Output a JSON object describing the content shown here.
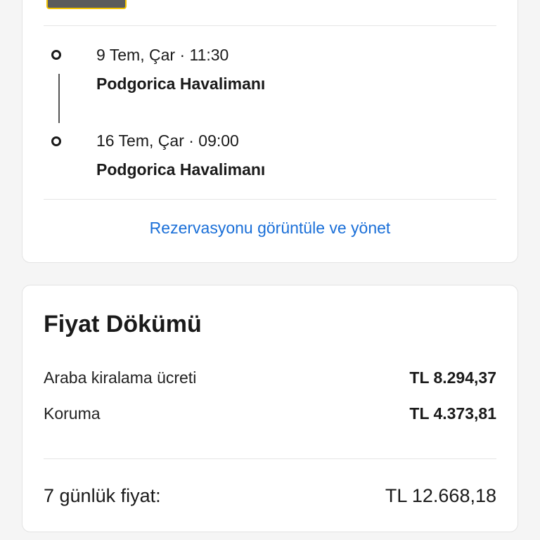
{
  "trip": {
    "pickup": {
      "datetime": "9 Tem, Çar · 11:30",
      "location": "Podgorica Havalimanı"
    },
    "dropoff": {
      "datetime": "16 Tem, Çar · 09:00",
      "location": "Podgorica Havalimanı"
    },
    "manage_link": "Rezervasyonu görüntüle ve yönet"
  },
  "price": {
    "title": "Fiyat Dökümü",
    "rows": [
      {
        "label": "Araba kiralama ücreti",
        "value": "TL 8.294,37"
      },
      {
        "label": "Koruma",
        "value": "TL 4.373,81"
      }
    ],
    "total_label": "7 günlük fiyat:",
    "total_value": "TL 12.668,18"
  },
  "colors": {
    "link": "#1a6fd8",
    "thumb_border": "#f2c200"
  }
}
